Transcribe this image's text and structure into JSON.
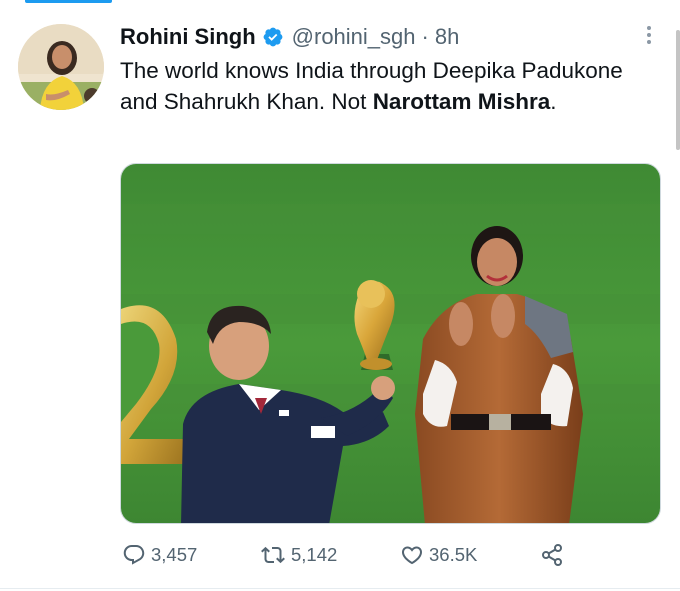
{
  "tweet": {
    "author_name": "Rohini Singh",
    "handle": "@rohini_sgh",
    "separator": "·",
    "time": "8h",
    "text_part1": "The world knows India through Deepika Padukone and Shahrukh Khan. Not ",
    "text_bold": "Narottam Mishra",
    "text_part2": "."
  },
  "actions": {
    "replies": "3,457",
    "retweets": "5,142",
    "likes": "36.5K"
  },
  "icons": {
    "verified": "verified-badge-icon",
    "more": "more-vertical-icon",
    "reply": "reply-bubble-icon",
    "retweet": "retweet-icon",
    "like": "heart-icon",
    "share": "share-icon"
  },
  "colors": {
    "accent": "#1d9bf0",
    "text": "#0f1419",
    "muted": "#536471"
  }
}
